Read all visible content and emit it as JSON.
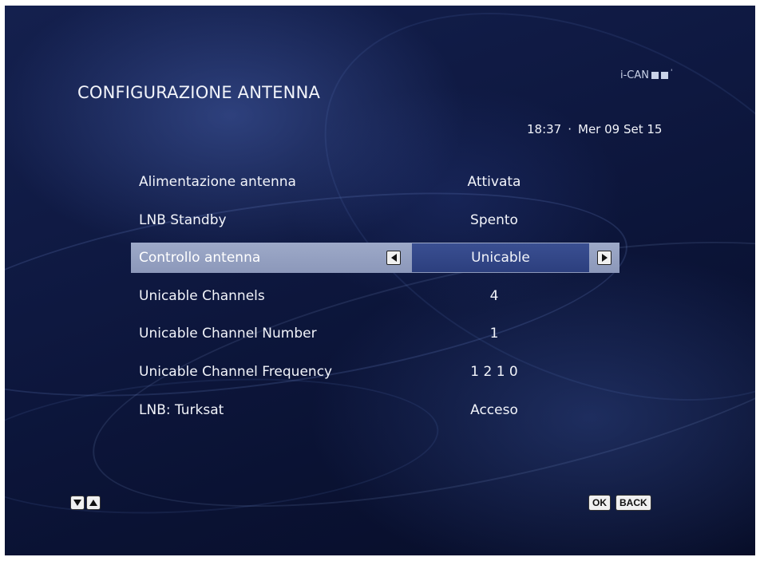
{
  "screen": {
    "title": "CONFIGURAZIONE ANTENNA",
    "brand": "i-CAN",
    "time": "18:37",
    "separator": "·",
    "date": "Mer 09 Set 15"
  },
  "settings": [
    {
      "label": "Alimentazione antenna",
      "value": "Attivata",
      "selected": false
    },
    {
      "label": "LNB Standby",
      "value": "Spento",
      "selected": false
    },
    {
      "label": "Controllo antenna",
      "value": "Unicable",
      "selected": true
    },
    {
      "label": "Unicable Channels",
      "value": "4",
      "selected": false
    },
    {
      "label": "Unicable Channel Number",
      "value": "1",
      "selected": false
    },
    {
      "label": "Unicable Channel Frequency",
      "value": "1 2 1 0",
      "selected": false
    },
    {
      "label": "LNB: Turksat",
      "value": "Acceso",
      "selected": false
    }
  ],
  "footer": {
    "nav_icons": [
      "arrow-down-icon",
      "arrow-up-icon"
    ],
    "ok_label": "OK",
    "back_label": "BACK"
  },
  "colors": {
    "background": "#0e1840",
    "selection_row": "#9da9c8",
    "selection_value": "#3a4f92",
    "text": "#f2f4fa"
  }
}
